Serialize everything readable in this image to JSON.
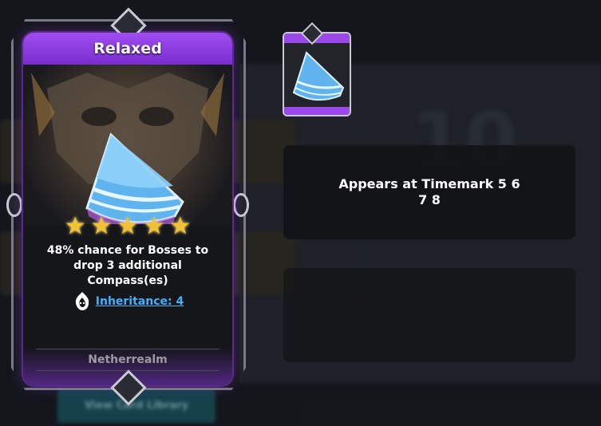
{
  "card": {
    "title": "Relaxed",
    "star_count": 5,
    "stars": [
      "★",
      "★",
      "★",
      "★",
      "★"
    ],
    "description": "48% chance for Bosses to drop 3 additional Compass(es)",
    "inheritance_label": "Inheritance: 4",
    "origin": "Netherrealm",
    "rarity_color": "#9b48ea"
  },
  "info_panel": {
    "timemark_text": "Appears at Timemark 5 6 7 8"
  },
  "background": {
    "button_label": "View Card Library",
    "big_number": "10"
  },
  "icons": {
    "inheritance": "flame-skull-icon",
    "star": "star-icon",
    "card_art": "compass-shard-icon"
  }
}
